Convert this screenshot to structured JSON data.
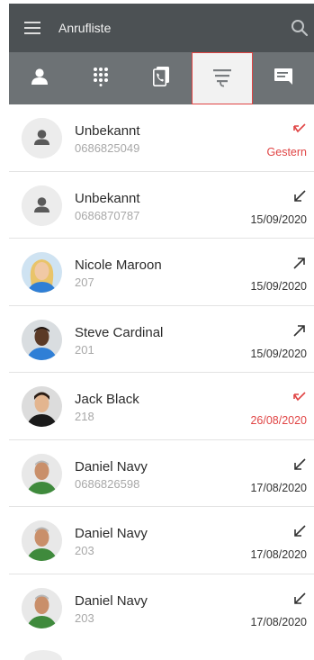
{
  "header": {
    "title": "Anrufliste"
  },
  "tabs": [
    {
      "icon": "contact-icon"
    },
    {
      "icon": "dialpad-icon"
    },
    {
      "icon": "phonebook-icon"
    },
    {
      "icon": "call-history-icon",
      "active": true
    },
    {
      "icon": "chat-icon"
    }
  ],
  "calls": [
    {
      "name": "Unbekannt",
      "number": "0686825049",
      "date": "Gestern",
      "type": "missed",
      "avatar": "placeholder"
    },
    {
      "name": "Unbekannt",
      "number": "0686870787",
      "date": "15/09/2020",
      "type": "incoming",
      "avatar": "placeholder"
    },
    {
      "name": "Nicole Maroon",
      "number": "207",
      "date": "15/09/2020",
      "type": "outgoing",
      "avatar": "nicole"
    },
    {
      "name": "Steve Cardinal",
      "number": "201",
      "date": "15/09/2020",
      "type": "outgoing",
      "avatar": "steve"
    },
    {
      "name": "Jack Black",
      "number": "218",
      "date": "26/08/2020",
      "type": "missed",
      "avatar": "jack"
    },
    {
      "name": "Daniel Navy",
      "number": "0686826598",
      "date": "17/08/2020",
      "type": "incoming",
      "avatar": "daniel"
    },
    {
      "name": "Daniel Navy",
      "number": "203",
      "date": "17/08/2020",
      "type": "incoming",
      "avatar": "daniel"
    },
    {
      "name": "Daniel Navy",
      "number": "203",
      "date": "17/08/2020",
      "type": "incoming",
      "avatar": "daniel"
    }
  ],
  "colors": {
    "header_bg": "#4c5154",
    "tabbar_bg": "#6d7275",
    "missed": "#e04444",
    "active_tab_bg": "#f2f2f2"
  }
}
